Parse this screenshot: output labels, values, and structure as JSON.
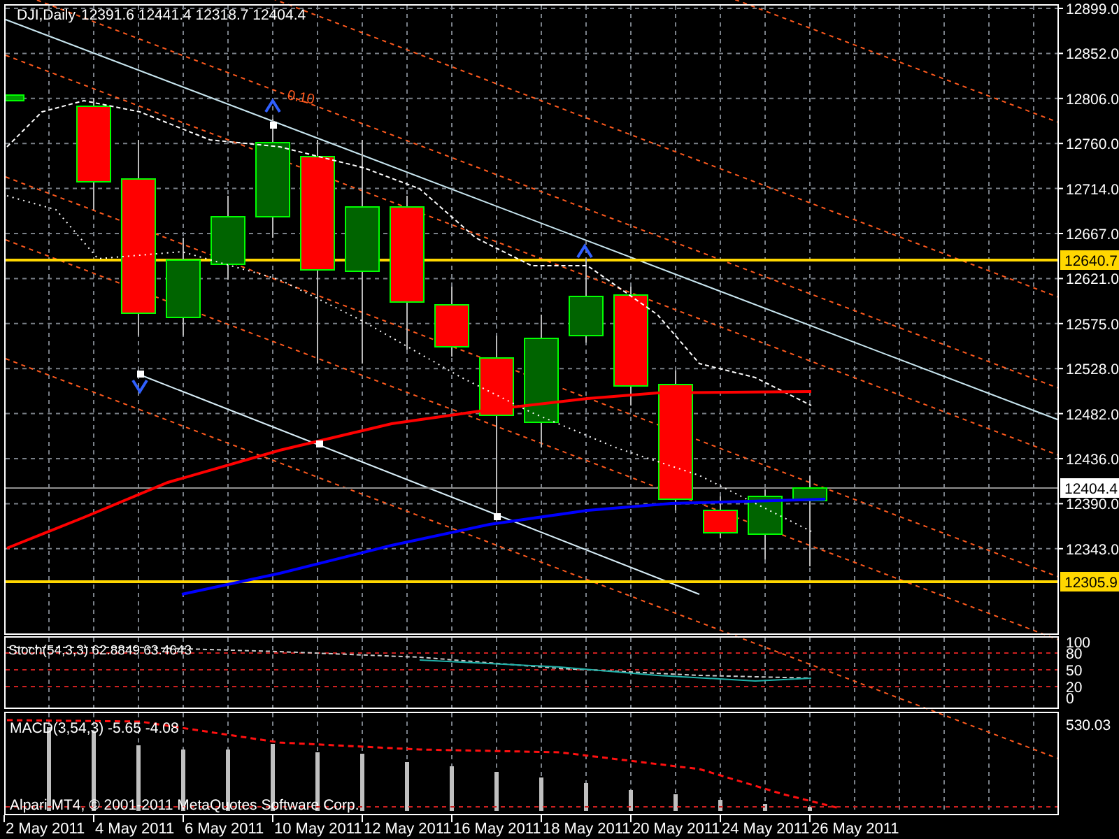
{
  "header": {
    "symbol": "DJI,Daily",
    "ohlc": "12391.6 12441.4 12318.7 12404.4"
  },
  "price_axis": {
    "ticks": [
      "12899.0",
      "12852.0",
      "12806.0",
      "12760.0",
      "12714.0",
      "12667.0",
      "12621.0",
      "12575.0",
      "12528.0",
      "12482.0",
      "12436.0",
      "12390.0",
      "12343.0"
    ]
  },
  "price_labels": [
    {
      "kind": "line",
      "text": "12640.7"
    },
    {
      "kind": "bid",
      "text": "12404.4"
    },
    {
      "kind": "line",
      "text": "12305.9"
    }
  ],
  "fibo_label": "0.10",
  "stochastic": {
    "label": "Stoch(54,3,3) 62.8849 63.4643",
    "levels": [
      "100",
      "80",
      "50",
      "20",
      "0"
    ]
  },
  "macd": {
    "label": "MACD(3,54,3) -5.65 -4.08",
    "scale": "530.03"
  },
  "copyright": "Alpari MT4, © 2001-2011 MetaQuotes Software Corp.",
  "dates": [
    "2 May 2011",
    "4 May 2011",
    "6 May 2011",
    "10 May 2011",
    "12 May 2011",
    "16 May 2011",
    "18 May 2011",
    "20 May 2011",
    "24 May 2011",
    "26 May 2011"
  ]
}
